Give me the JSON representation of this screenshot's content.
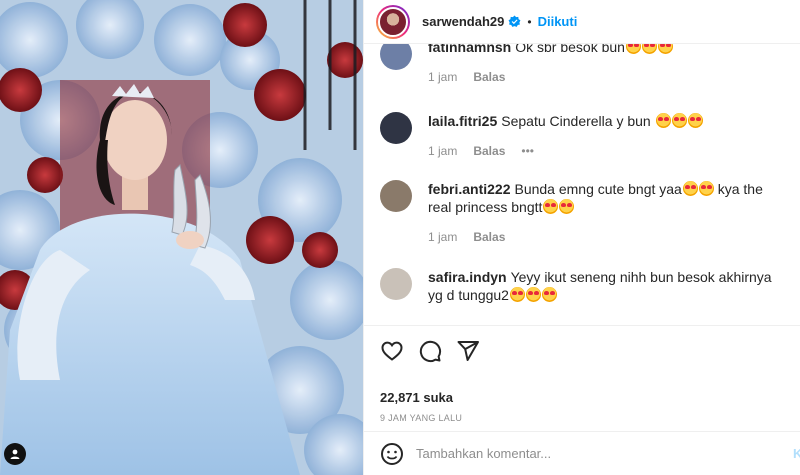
{
  "header": {
    "username": "sarwendah29",
    "verified_icon": "verified-badge-icon",
    "separator": "•",
    "follow_label": "Diikuti"
  },
  "comments": [
    {
      "username": "fatinhamnsh",
      "text": "Ok sbr besok bun",
      "emoji_count": 3,
      "time": "1 jam",
      "reply": "Balas",
      "avatar_color": "#6d7fa6"
    },
    {
      "username": "laila.fitri25",
      "text": "Sepatu Cinderella y bun",
      "emoji_count": 3,
      "time": "1 jam",
      "reply": "Balas",
      "more": "•••",
      "avatar_color": "#2f3444"
    },
    {
      "username": "febri.anti222",
      "text": "Bunda emng cute bngt yaa",
      "text2": "kya the real princess bngtt",
      "emoji_count": 2,
      "emoji_count2": 2,
      "time": "1 jam",
      "reply": "Balas",
      "avatar_color": "#8a7a6a"
    },
    {
      "username": "safira.indyn",
      "text": "Yeyy ikut seneng nihh bun besok akhirnya yg d tunggu2",
      "emoji_count": 3,
      "avatar_color": "#c9c1b8"
    }
  ],
  "actions": {
    "like_icon": "heart-icon",
    "comment_icon": "comment-icon",
    "share_icon": "share-icon",
    "likes": "22,871 suka",
    "timestamp": "9 JAM YANG LALU"
  },
  "add_comment": {
    "placeholder": "Tambahkan komentar...",
    "post_label": "Ki"
  },
  "colors": {
    "accent": "#0095f6",
    "text": "#262626",
    "muted": "#8e8e8e"
  }
}
